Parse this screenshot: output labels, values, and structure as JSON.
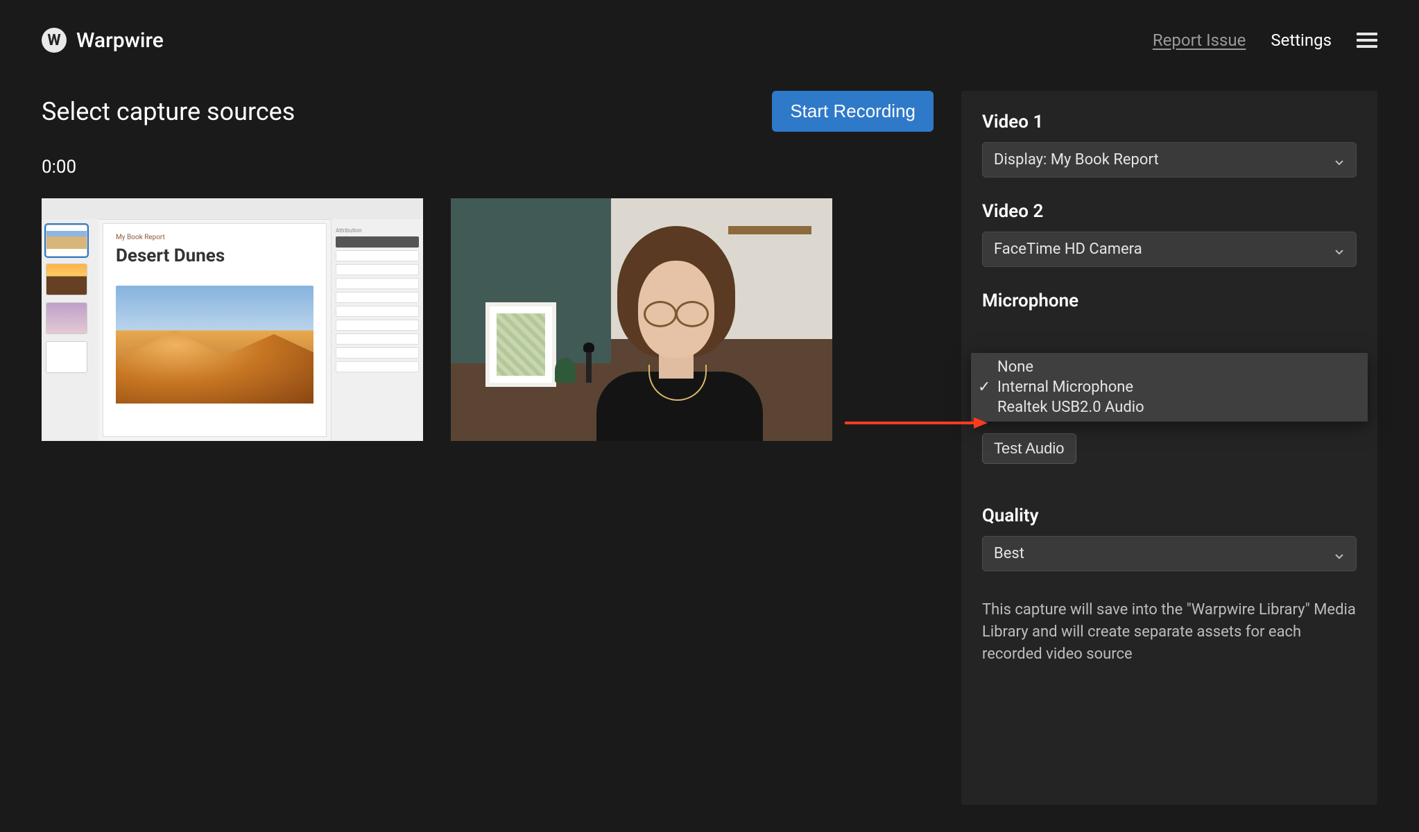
{
  "brand": {
    "name": "Warpwire",
    "logo_letter": "W"
  },
  "header": {
    "report": "Report Issue",
    "settings": "Settings"
  },
  "title": "Select capture sources",
  "start_label": "Start Recording",
  "timer": "0:00",
  "preview1": {
    "doc_subtitle": "My Book Report",
    "doc_title": "Desert Dunes",
    "inspector_title": "Attribution"
  },
  "panel": {
    "video1_label": "Video 1",
    "video1_value": "Display: My Book Report",
    "video2_label": "Video 2",
    "video2_value": "FaceTime HD Camera",
    "mic_label": "Microphone",
    "mic_options": {
      "none": "None",
      "internal": "Internal Microphone",
      "realtek": "Realtek USB2.0 Audio"
    },
    "mic_selected_index": 1,
    "test_audio": "Test Audio",
    "quality_label": "Quality",
    "quality_value": "Best",
    "description": "This capture will save into the \"Warpwire Library\" Media Library and will create separate assets for each recorded video source"
  }
}
